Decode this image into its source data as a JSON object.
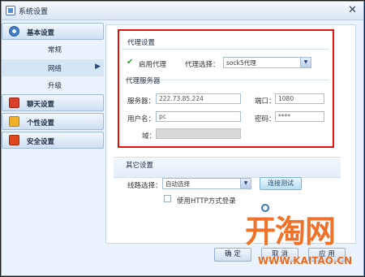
{
  "window": {
    "title": "系统设置"
  },
  "sidebar": {
    "groups": [
      {
        "label": "基本设置",
        "icon": "gear-icon",
        "items": [
          {
            "label": "常规"
          },
          {
            "label": "网络"
          },
          {
            "label": "升级"
          }
        ]
      },
      {
        "label": "聊天设置",
        "icon": "chat-icon"
      },
      {
        "label": "个性设置",
        "icon": "brush-icon"
      },
      {
        "label": "安全设置",
        "icon": "lock-icon"
      }
    ],
    "active_item": "网络"
  },
  "proxy": {
    "section_title": "代理设置",
    "enable_label": "启用代理",
    "enable_checked": true,
    "select_label": "代理选择：",
    "select_value": "sock5代理",
    "server_section_title": "代理服务器",
    "server_label": "服务器：",
    "server_value": "222.73.85.224",
    "port_label": "端口：",
    "port_value": "1080",
    "user_label": "用户名：",
    "user_value": "pc",
    "password_label": "密码：",
    "password_value": "****",
    "domain_label": "域："
  },
  "other": {
    "section_title": "其它设置",
    "route_label": "线路选择：",
    "route_value": "自动选择",
    "test_button": "连接测试",
    "http_login_label": "使用HTTP方式登录",
    "http_login_checked": false
  },
  "footer": {
    "ok_label": "确 定",
    "cancel_label": "取 消",
    "apply_label": "应 用"
  },
  "watermark": {
    "logo": "开淘网",
    "url": "WWW.KAITAO.CN"
  }
}
